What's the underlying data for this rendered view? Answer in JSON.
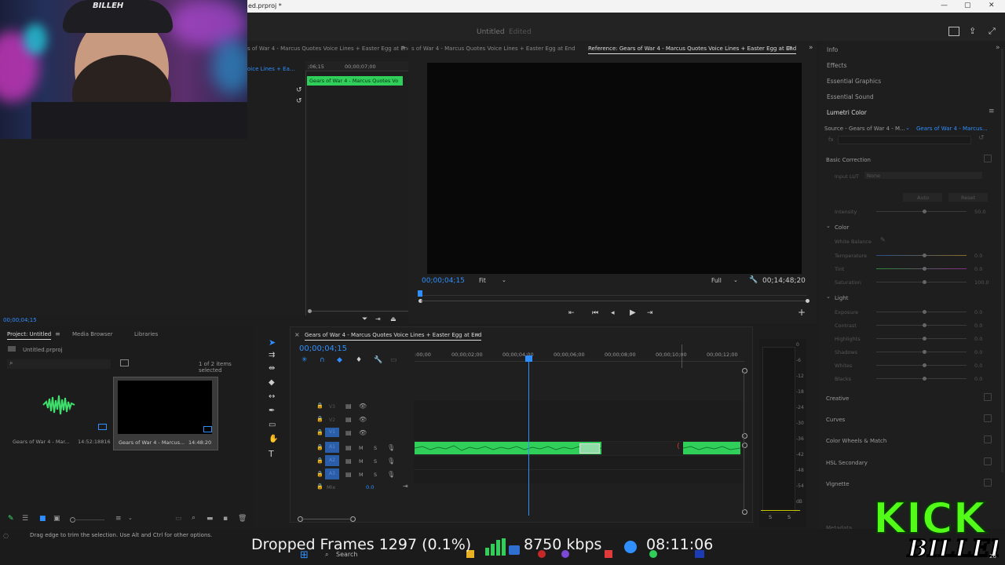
{
  "window": {
    "title": "ed.prproj *",
    "minimize": "—",
    "maximize": "▢",
    "close": "✕"
  },
  "header": {
    "doc_title": "Untitled",
    "doc_state": "Edited"
  },
  "source_monitor": {
    "header_label": "s of War 4 - Marcus Quotes Voice Lines + Easter Egg at End",
    "sequence_label": "oice Lines + Ea...",
    "ruler_left": ";06;15",
    "ruler_right": "00;00;07;00",
    "clip_label": "Gears of War 4 - Marcus Quotes Vo",
    "timecode": "00;00;04;15"
  },
  "program_monitor": {
    "tab_inactive": "s of War 4 - Marcus Quotes Voice Lines + Easter Egg at End",
    "tab_active": "Reference: Gears of War 4 - Marcus Quotes Voice Lines + Easter Egg at End",
    "timecode": "00;00;04;15",
    "fit": "Fit",
    "resolution": "Full",
    "duration": "00;14;48;20"
  },
  "right_panel": {
    "items": [
      "Info",
      "Effects",
      "Essential Graphics",
      "Essential Sound",
      "Lumetri Color"
    ],
    "source_label": "Source - Gears of War 4 - M...",
    "target_label": "Gears of War 4 - Marcus...",
    "fx_label": "fx",
    "basic_correction": "Basic Correction",
    "input_lut": "Input LUT",
    "input_lut_value": "None",
    "auto": "Auto",
    "reset": "Reset",
    "intensity": "Intensity",
    "intensity_value": "50.0",
    "color": "Color",
    "white_balance": "White Balance",
    "color_params": [
      {
        "name": "Temperature",
        "value": "0.0"
      },
      {
        "name": "Tint",
        "value": "0.0"
      },
      {
        "name": "Saturation",
        "value": "100.0"
      }
    ],
    "light": "Light",
    "light_params": [
      {
        "name": "Exposure",
        "value": "0.0"
      },
      {
        "name": "Contrast",
        "value": "0.0"
      },
      {
        "name": "Highlights",
        "value": "0.0"
      },
      {
        "name": "Shadows",
        "value": "0.0"
      },
      {
        "name": "Whites",
        "value": "0.0"
      },
      {
        "name": "Blacks",
        "value": "0.0"
      }
    ],
    "sections": [
      "Creative",
      "Curves",
      "Color Wheels & Match",
      "HSL Secondary",
      "Vignette"
    ],
    "footer": "Metadata"
  },
  "project": {
    "tabs": [
      "Project: Untitled",
      "Media Browser",
      "Libraries"
    ],
    "filename": "Untitled.prproj",
    "items_selected": "1 of 2 items selected",
    "items": [
      {
        "name": "Gears of War 4 - Mar...",
        "duration": "14:52:18816"
      },
      {
        "name": "Gears of War 4 - Marcus...",
        "duration": "14:48:20"
      }
    ]
  },
  "timeline": {
    "title": "Gears of War 4 - Marcus Quotes Voice Lines + Easter Egg at End",
    "timecode": "00;00;04;15",
    "ruler": [
      ":00;00",
      "00;00;02;00",
      "00;00;04;00",
      "00;00;06;00",
      "00;00;08;00",
      "00;00;10;00",
      "00;00;12;00"
    ],
    "video_tracks": [
      "V3",
      "V2",
      "V1"
    ],
    "audio_tracks": [
      "A1",
      "A2",
      "A3"
    ],
    "mix": "Mix",
    "mix_value": "0.0",
    "m": "M",
    "s": "S"
  },
  "meter": {
    "scale": [
      "0",
      "-6",
      "-12",
      "-18",
      "-24",
      "-30",
      "-36",
      "-42",
      "-48",
      "-54",
      "dB"
    ],
    "ch_l": "S",
    "ch_r": "S"
  },
  "status_bar": {
    "hint": "Drag edge to trim the selection. Use Alt and Ctrl for other options."
  },
  "overlay": {
    "dropped_frames": "Dropped Frames 1297 (0.1%)",
    "bitrate": "8750 kbps",
    "clock": "08:11:06"
  },
  "branding": {
    "kick_text": "KICK",
    "name": "BILLEH",
    "corner": "26"
  },
  "taskbar": {
    "search": "Search"
  },
  "colors": {
    "accent_blue": "#2f8fff",
    "clip_green": "#2fcf5a",
    "kick_green": "#53fc18"
  }
}
